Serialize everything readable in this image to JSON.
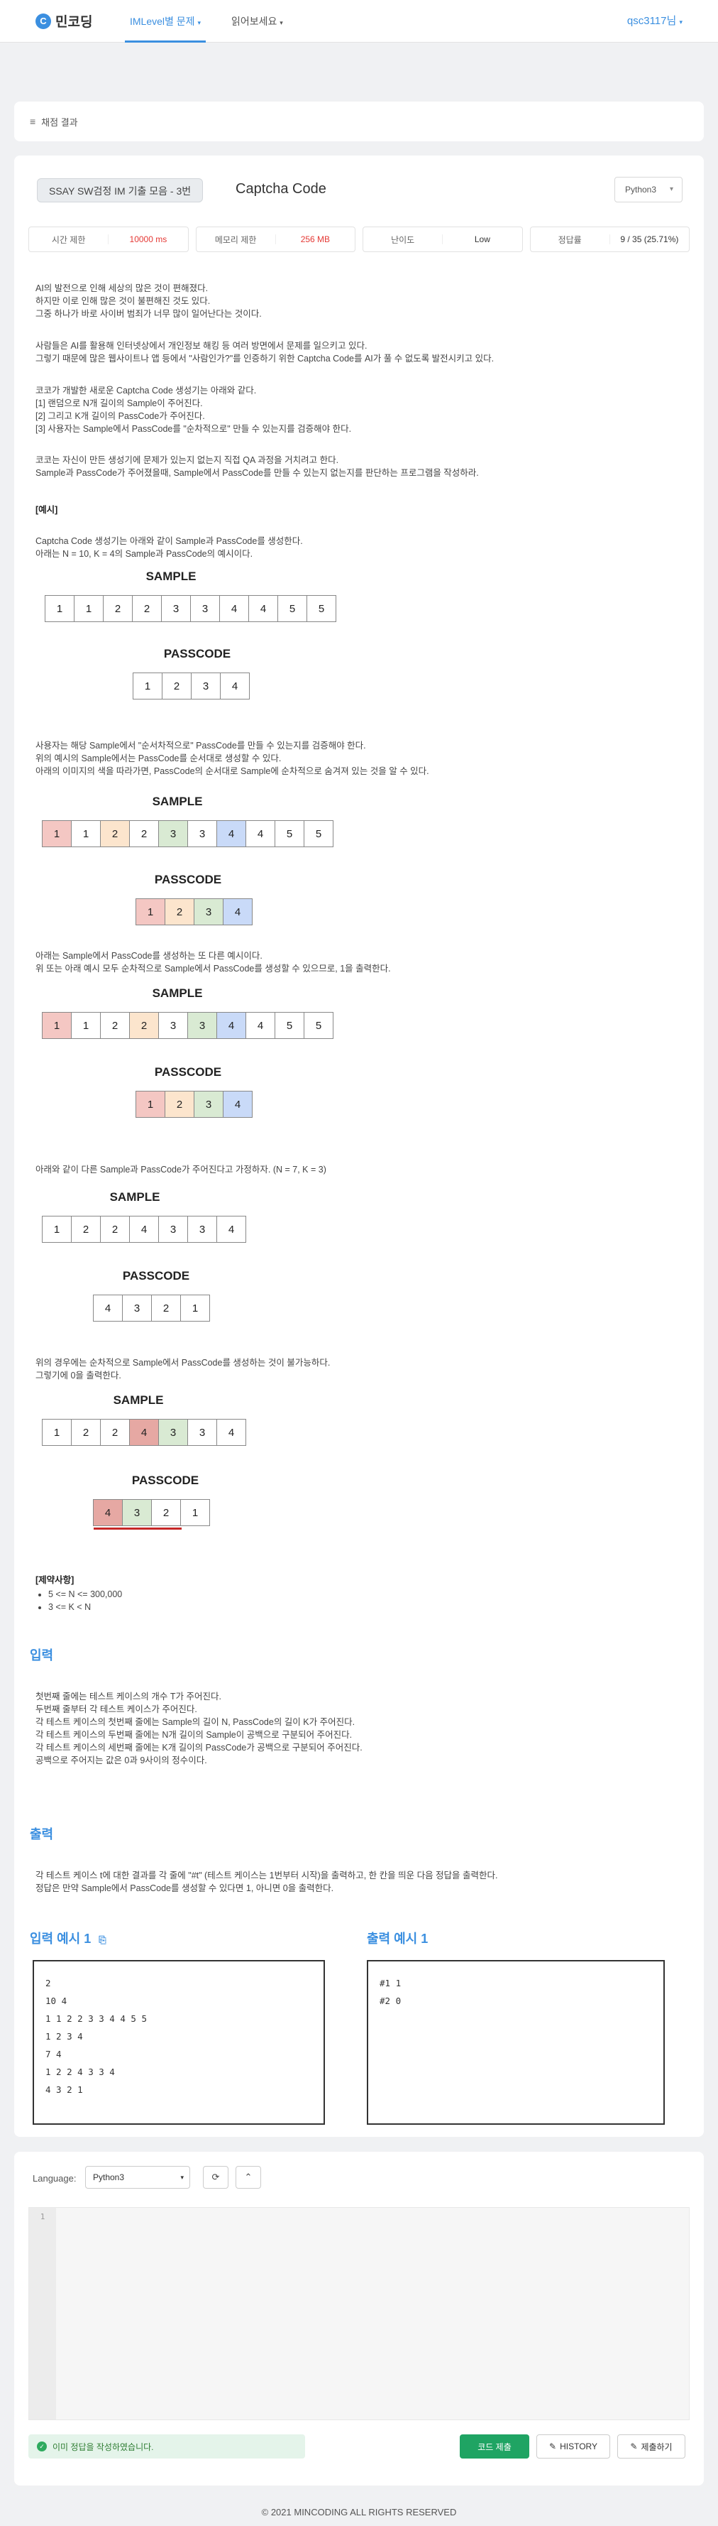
{
  "nav": {
    "logo": "민코딩",
    "items": [
      "IMLevel별 문제",
      "읽어보세요"
    ],
    "user": "qsc3117님"
  },
  "result": {
    "label": "채점 결과"
  },
  "problem": {
    "category": "SSAY SW검정 IM 기출 모음 - 3번",
    "title": "Captcha Code",
    "language_pill": "Python3",
    "info": [
      {
        "key": "시간 제한",
        "value": "10000 ms"
      },
      {
        "key": "메모리 제한",
        "value": "256 MB"
      },
      {
        "key": "난이도",
        "value": "Low"
      },
      {
        "key": "정답률",
        "value": "9 / 35 (25.71%)"
      }
    ],
    "intro": [
      "AI의 발전으로 인해 세상의 많은 것이 편해졌다.",
      "하지만 이로 인해 많은 것이 불편해진 것도 있다.",
      "그중 하나가 바로 사이버 범죄가 너무 많이 일어난다는 것이다."
    ],
    "para2": [
      "사람들은 AI를 활용해 인터넷상에서 개인정보 해킹 등 여러 방면에서 문제를 일으키고 있다.",
      "그렇기 때문에 많은 웹사이트나 앱 등에서 \"사람인가?\"를 인증하기 위한 Captcha Code를 AI가 풀 수 없도록 발전시키고 있다."
    ],
    "para3": [
      "코코가 개발한 새로운 Captcha Code 생성기는 아래와 같다.",
      "[1] 랜덤으로 N개 길이의 Sample이 주어진다.",
      "[2] 그리고 K개 길이의 PassCode가 주어진다.",
      "[3] 사용자는 Sample에서 PassCode를 \"순차적으로\" 만들 수 있는지를 검증해야 한다."
    ],
    "para4": [
      "코코는 자신이 만든 생성기에 문제가 있는지 없는지 직접 QA 과정을 거치려고 한다.",
      "Sample과 PassCode가 주어졌을때, Sample에서 PassCode를 만들 수 있는지 없는지를 판단하는 프로그램을 작성하라."
    ],
    "example_label": "[예시]",
    "ex_intro": [
      "Captcha Code 생성기는 아래와 같이 Sample과 PassCode를 생성한다.",
      "아래는 N = 10, K = 4의 Sample과 PassCode의 예시이다."
    ],
    "sample_title": "SAMPLE",
    "passcode_title": "PASSCODE",
    "diagram1": {
      "sample": [
        "1",
        "1",
        "2",
        "2",
        "3",
        "3",
        "4",
        "4",
        "5",
        "5"
      ],
      "passcode": [
        "1",
        "2",
        "3",
        "4"
      ]
    },
    "check_text": [
      "사용자는 해당 Sample에서 \"순서차적으로\" PassCode를 만들 수 있는지를 검증해야 한다.",
      "위의 예시의 Sample에서는 PassCode를 순서대로 생성할 수 있다.",
      "아래의 이미지의 색을 따라가면, PassCode의 순서대로 Sample에 순차적으로 숨겨져 있는 것을 알 수 있다."
    ],
    "diagram2": {
      "sample": [
        "1",
        "1",
        "2",
        "2",
        "3",
        "3",
        "4",
        "4",
        "5",
        "5"
      ],
      "passcode": [
        "1",
        "2",
        "3",
        "4"
      ]
    },
    "another_text": [
      "아래는 Sample에서 PassCode를 생성하는 또 다른 예시이다.",
      "위 또는 아래 예시 모두 순차적으로 Sample에서 PassCode를 생성할 수 있으므로, 1을 출력한다."
    ],
    "diagram3": {
      "sample": [
        "1",
        "1",
        "2",
        "2",
        "3",
        "3",
        "4",
        "4",
        "5",
        "5"
      ],
      "passcode": [
        "1",
        "2",
        "3",
        "4"
      ]
    },
    "nk_text": [
      "아래와 같이 다른 Sample과 PassCode가 주어진다고 가정하자. (N = 7, K = 3)"
    ],
    "diagram4": {
      "sample": [
        "1",
        "2",
        "2",
        "4",
        "3",
        "3",
        "4"
      ],
      "passcode": [
        "4",
        "3",
        "2",
        "1"
      ]
    },
    "impossible_text": [
      "위의 경우에는 순차적으로 Sample에서 PassCode를 생성하는 것이 불가능하다.",
      "그렇기에 0을 출력한다."
    ],
    "diagram5": {
      "sample": [
        "1",
        "2",
        "2",
        "4",
        "3",
        "3",
        "4"
      ],
      "passcode": [
        "4",
        "3",
        "2",
        "1"
      ]
    },
    "constraints_label": "[제약사항]",
    "constraints": [
      "5 <= N <= 300,000",
      "3 <= K < N"
    ],
    "input_head": "입력",
    "input_lines": [
      "첫번째 줄에는 테스트 케이스의 개수 T가 주어진다.",
      "두번째 줄부터 각 테스트 케이스가 주어진다.",
      "각 테스트 케이스의 첫번째 줄에는 Sample의 길이 N, PassCode의 길이 K가 주어진다.",
      "각 테스트 케이스의 두번째 줄에는 N개 길이의 Sample이 공백으로 구분되어 주어진다.",
      "각 테스트 케이스의 세번째 줄에는 K개 길이의 PassCode가 공백으로 구분되어 주어진다.",
      "공백으로 주어지는 값은 0과 9사이의 정수이다."
    ],
    "output_head": "출력",
    "output_lines": [
      "각 테스트 케이스 t에 대한 결과를 각 줄에 \"#t\" (테스트 케이스는 1번부터 시작)을 출력하고, 한 칸을 띄운 다음 정답을 출력한다.",
      "정답은 만약 Sample에서 PassCode를 생성할 수 있다면 1, 아니면 0을 출력한다."
    ],
    "input_example_head": "입력 예시 1",
    "output_example_head": "출력 예시 1",
    "input_example": "2\n10 4\n1 1 2 2 3 3 4 4 5 5\n1 2 3 4\n7 4\n1 2 2 4 3 3 4\n4 3 2 1",
    "output_example": "#1 1\n#2 0"
  },
  "editor": {
    "language_label": "Language:",
    "language": "Python3",
    "line_number": "1",
    "status": "이미 정답을 작성하였습니다.",
    "submit_label": "코드 제출",
    "history_label": "HISTORY",
    "save_label": "제출하기"
  },
  "footer": "© 2021 MINCODING ALL RIGHTS RESERVED",
  "colors": {
    "accent": "#3b8fe0",
    "red_cell": "#f4c7c3",
    "orange_cell": "#fce5cd",
    "green_cell": "#d9ead3",
    "blue_cell": "#c9daf8",
    "submit_green": "#1fa463"
  }
}
